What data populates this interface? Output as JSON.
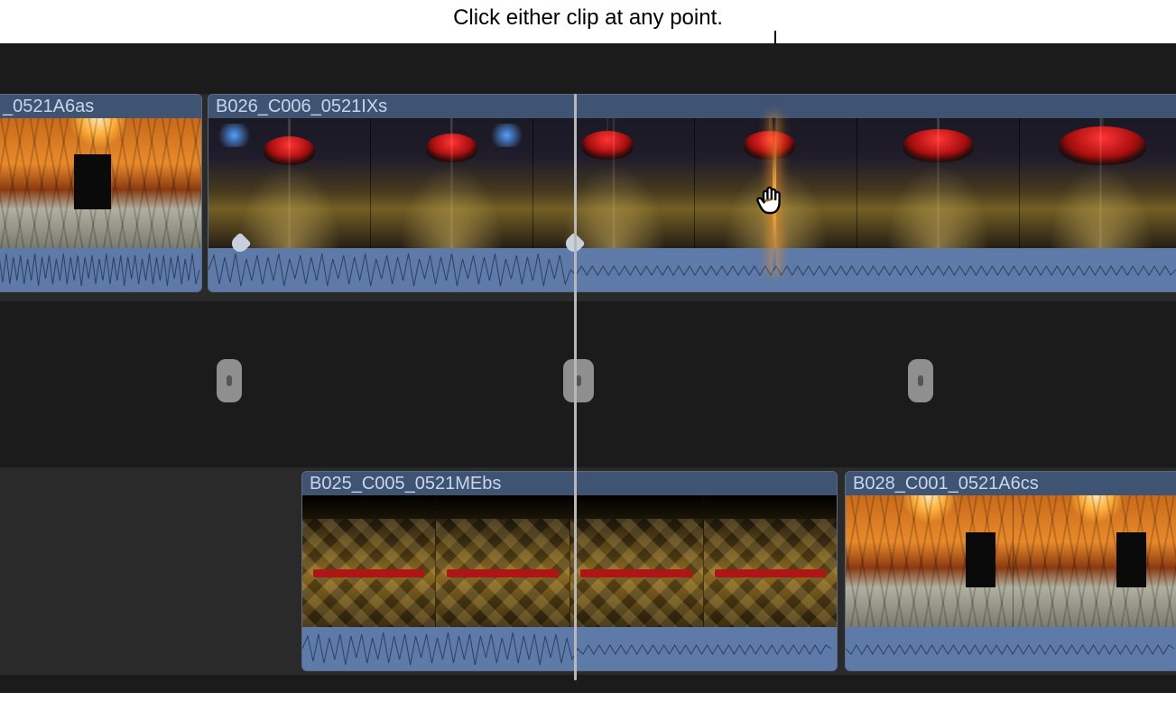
{
  "annotation": {
    "text": "Click either clip at any point."
  },
  "cursor": {
    "name": "hand-cursor"
  },
  "tracks": {
    "upper": {
      "clips": [
        {
          "label": "_0521A6as"
        },
        {
          "label": "B026_C006_0521IXs"
        }
      ]
    },
    "lower": {
      "clips": [
        {
          "label": "B025_C005_0521MEbs"
        },
        {
          "label": "B028_C001_0521A6cs"
        }
      ]
    }
  }
}
